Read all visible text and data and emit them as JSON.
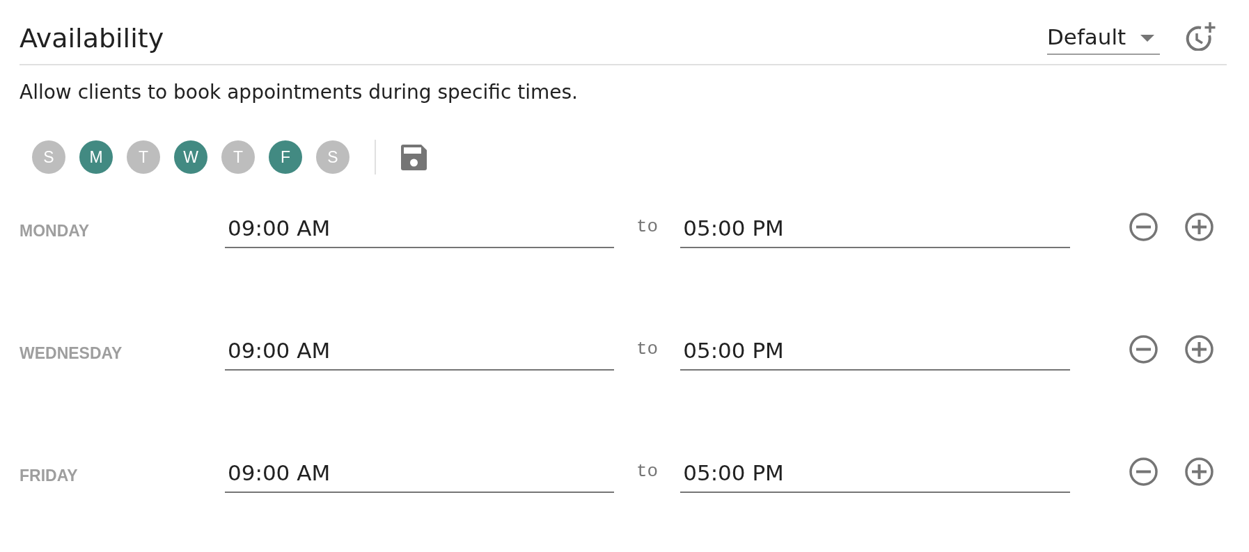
{
  "header": {
    "title": "Availability",
    "schedule": "Default"
  },
  "description": "Allow clients to book appointments during specific times.",
  "days": [
    {
      "letter": "S",
      "selected": false
    },
    {
      "letter": "M",
      "selected": true
    },
    {
      "letter": "T",
      "selected": false
    },
    {
      "letter": "W",
      "selected": true
    },
    {
      "letter": "T",
      "selected": false
    },
    {
      "letter": "F",
      "selected": true
    },
    {
      "letter": "S",
      "selected": false
    }
  ],
  "rows": [
    {
      "day": "MONDAY",
      "start": "09:00 AM",
      "separator": "to",
      "end": "05:00 PM"
    },
    {
      "day": "WEDNESDAY",
      "start": "09:00 AM",
      "separator": "to",
      "end": "05:00 PM"
    },
    {
      "day": "FRIDAY",
      "start": "09:00 AM",
      "separator": "to",
      "end": "05:00 PM"
    }
  ]
}
